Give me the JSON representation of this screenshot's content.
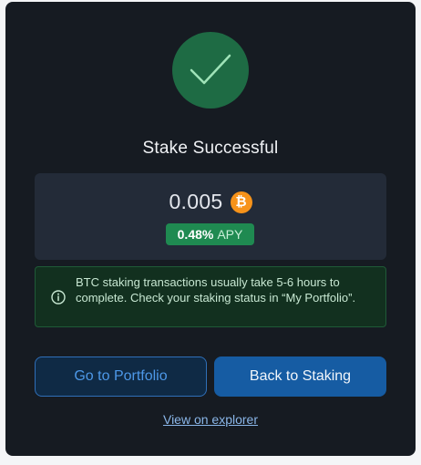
{
  "dialog": {
    "title": "Stake Successful"
  },
  "amount": {
    "value": "0.005",
    "currency_icon": "bitcoin-icon",
    "currency_symbol": "₿",
    "apy_value": "0.48%",
    "apy_label": "APY"
  },
  "info": {
    "icon": "info-icon",
    "message": "BTC staking transactions usually take 5-6 hours to complete. Check your staking status in “My Portfolio”."
  },
  "actions": {
    "portfolio_label": "Go to Portfolio",
    "staking_label": "Back to Staking",
    "explorer_label": "View on explorer"
  },
  "colors": {
    "background": "#161b22",
    "success": "#1e6b44",
    "accent": "#165ca3",
    "bitcoin": "#f7931a"
  }
}
